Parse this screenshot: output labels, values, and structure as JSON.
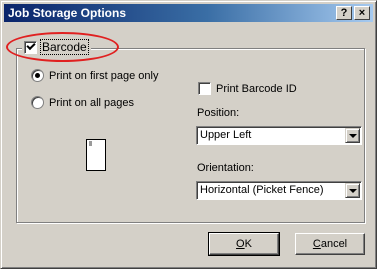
{
  "window": {
    "title": "Job Storage Options",
    "help_button": "?",
    "close_button": "×"
  },
  "barcode": {
    "label": "Barcode",
    "checked": true
  },
  "print_options": [
    {
      "label": "Print on first page only",
      "selected": true
    },
    {
      "label": "Print on all pages",
      "selected": false
    }
  ],
  "print_barcode_id": {
    "label": "Print Barcode ID",
    "checked": false
  },
  "position": {
    "label": "Position:",
    "value": "Upper Left"
  },
  "orientation": {
    "label": "Orientation:",
    "value": "Horizontal (Picket Fence)"
  },
  "buttons": {
    "ok_mnemonic": "O",
    "ok_rest": "K",
    "cancel_mnemonic": "C",
    "cancel_rest": "ancel"
  },
  "colors": {
    "titlebar_start": "#0a246a",
    "titlebar_end": "#a6caf0",
    "dialog_face": "#d4d0c8",
    "highlight": "#e02020"
  },
  "icons": {
    "page_preview": "barcode-page-icon"
  }
}
